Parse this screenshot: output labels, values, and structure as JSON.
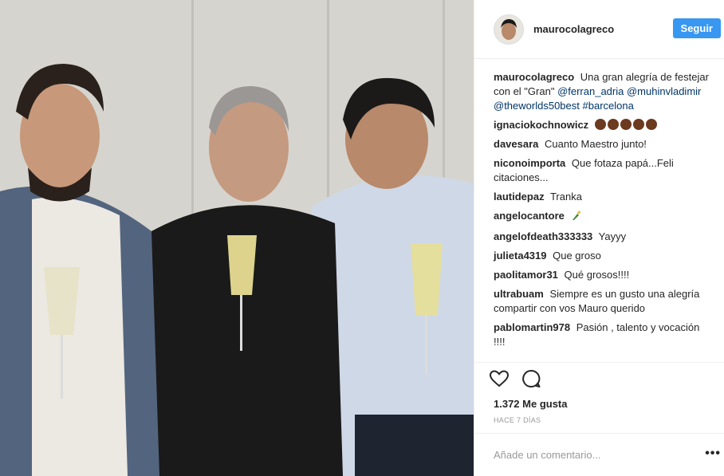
{
  "post": {
    "author": "maurocolagreco",
    "follow_label": "Seguir",
    "caption": {
      "user": "maurocolagreco",
      "text": "Una gran alegría de festejar con el \"Gran\"",
      "mentions": [
        "@ferran_adria",
        "@muhinvladimir",
        "@theworlds50best",
        "#barcelona"
      ]
    },
    "comments": [
      {
        "user": "ignaciokochnowicz",
        "text": ""
      },
      {
        "user": "davesara",
        "text": "Cuanto Maestro junto!"
      },
      {
        "user": "niconoimporta",
        "text": "Que fotaza papá...Feli citaciones..."
      },
      {
        "user": "lautidepaz",
        "text": "Tranka"
      },
      {
        "user": "angelocantore",
        "text": ""
      },
      {
        "user": "angelofdeath333333",
        "text": "Yayyy"
      },
      {
        "user": "julieta4319",
        "text": "Que groso"
      },
      {
        "user": "paolitamor31",
        "text": "Qué grosos!!!!"
      },
      {
        "user": "ultrabuam",
        "text": "Siempre es un gusto una alegría compartir con vos Mauro querido"
      },
      {
        "user": "pablomartin978",
        "text": "Pasión , talento y vocación !!!!"
      }
    ],
    "likes": "1.372 Me gusta",
    "date": "HACE 7 DÍAS",
    "add_comment_placeholder": "Añade un comentario...",
    "more_label": "•••",
    "icons": {
      "like": "heart-icon",
      "comment": "comment-icon",
      "more": "more-options-icon"
    }
  }
}
